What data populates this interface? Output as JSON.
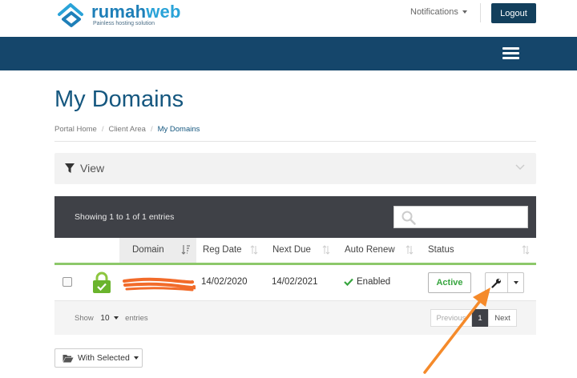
{
  "brand": {
    "name_a": "rumah",
    "name_b": "web",
    "tagline": "Painless hosting solution",
    "colors": {
      "primary": "#15466b",
      "accent": "#2aa3d8",
      "active": "#37a53f"
    }
  },
  "header": {
    "notifications_label": "Notifications",
    "logout_label": "Logout"
  },
  "navbar": {
    "menu_icon": "hamburger-icon"
  },
  "page": {
    "title": "My Domains",
    "breadcrumb": [
      {
        "label": "Portal Home"
      },
      {
        "label": "Client Area"
      },
      {
        "label": "My Domains",
        "active": true
      }
    ]
  },
  "view_panel": {
    "label": "View",
    "icon": "filter-icon",
    "toggle_icon": "chevron-down-icon"
  },
  "table": {
    "info": "Showing 1 to 1 of 1 entries",
    "search": {
      "placeholder": "",
      "value": ""
    },
    "columns": [
      {
        "label": ""
      },
      {
        "label": ""
      },
      {
        "label": "Domain"
      },
      {
        "label": "Reg Date"
      },
      {
        "label": "Next Due"
      },
      {
        "label": "Auto Renew"
      },
      {
        "label": "Status"
      },
      {
        "label": ""
      }
    ],
    "rows": [
      {
        "domain": "",
        "reg_date": "14/02/2020",
        "next_due": "14/02/2021",
        "auto_renew": "Enabled",
        "status": "Active",
        "lock_icon": "lock-icon",
        "tool_icon": "wrench-icon"
      }
    ],
    "footer": {
      "show_label": "Show",
      "page_size": "10",
      "entries_label": "entries",
      "pagination": {
        "previous": "Previous",
        "current": "1",
        "next": "Next"
      }
    }
  },
  "bulk_action": {
    "label": "With Selected",
    "icon": "folder-open-icon"
  }
}
